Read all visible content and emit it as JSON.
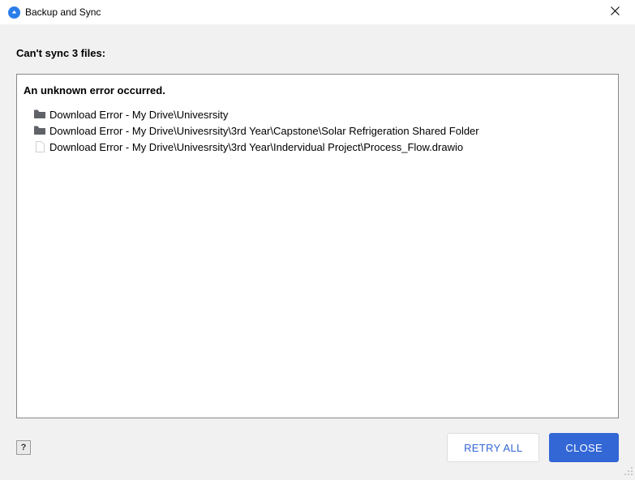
{
  "titlebar": {
    "title": "Backup and Sync"
  },
  "heading": "Can't sync 3 files:",
  "error_header": "An unknown error occurred.",
  "errors": [
    {
      "type": "folder",
      "text": "Download Error - My Drive\\Univesrsity"
    },
    {
      "type": "folder",
      "text": "Download Error - My Drive\\Univesrsity\\3rd Year\\Capstone\\Solar Refrigeration Shared Folder"
    },
    {
      "type": "file",
      "text": "Download Error - My Drive\\Univesrsity\\3rd Year\\Indervidual Project\\Process_Flow.drawio"
    }
  ],
  "footer": {
    "help": "?",
    "retry": "RETRY ALL",
    "close": "CLOSE"
  }
}
